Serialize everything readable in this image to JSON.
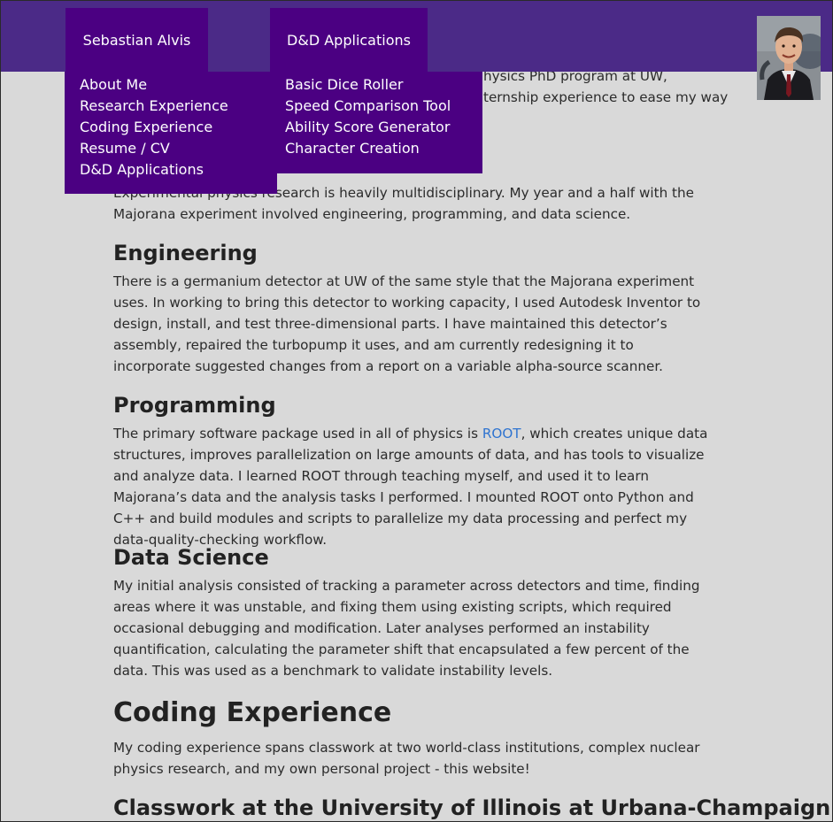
{
  "nav": {
    "tab1_label": "Sebastian Alvis",
    "tab2_label": "D&D Applications",
    "menu1": [
      "About Me",
      "Research Experience",
      "Coding Experience",
      "Resume / CV",
      "D&D Applications"
    ],
    "menu2": [
      "Basic Dice Roller",
      "Speed Comparison Tool",
      "Ability Score Generator",
      "Character Creation"
    ]
  },
  "hidden_fragments": {
    "line1": "hysics PhD program at UW,",
    "line2": "ternship experience to ease my way"
  },
  "intro": {
    "text": "Experimental physics research is heavily multidisciplinary. My year and a half with the Majorana experiment involved engineering, programming, and data science."
  },
  "engineering": {
    "heading": "Engineering",
    "text": "There is a germanium detector at UW of the same style that the Majorana experiment uses. In working to bring this detector to working capacity, I used Autodesk Inventor to design, install, and test three-dimensional parts. I have maintained this detector’s assembly, repaired the turbopump it uses, and am currently redesigning it to incorporate suggested changes from a report on a variable alpha-source scanner."
  },
  "programming": {
    "heading": "Programming",
    "text_before": "The primary software package used in all of physics is ",
    "link": "ROOT",
    "text_after": ", which creates unique data structures, improves parallelization on large amounts of data, and has tools to visualize and analyze data. I learned ROOT through teaching myself, and used it to learn Majorana’s data and the analysis tasks I performed. I mounted ROOT onto Python and C++ and build modules and scripts to parallelize my data processing and perfect my data-quality-checking workflow."
  },
  "data_science": {
    "heading": "Data Science",
    "text": "My initial analysis consisted of tracking a parameter across detectors and time, finding areas where it was unstable, and fixing them using existing scripts, which required occasional debugging and modification. Later analyses performed an instability quantification, calculating the parameter shift that encapsulated a few percent of the data. This was used as a benchmark to validate instability levels."
  },
  "coding": {
    "heading": "Coding Experience",
    "text": "My coding experience spans classwork at two world-class institutions, complex nuclear physics research, and my own personal project - this website!",
    "subheading": "Classwork at the University of Illinois at Urbana-Champaign"
  },
  "colors": {
    "topbar": "#4b2a87",
    "nav": "#4b0082",
    "background": "#d9d9d9",
    "link": "#2f74d0"
  },
  "icons": {
    "avatar": "profile-photo"
  }
}
